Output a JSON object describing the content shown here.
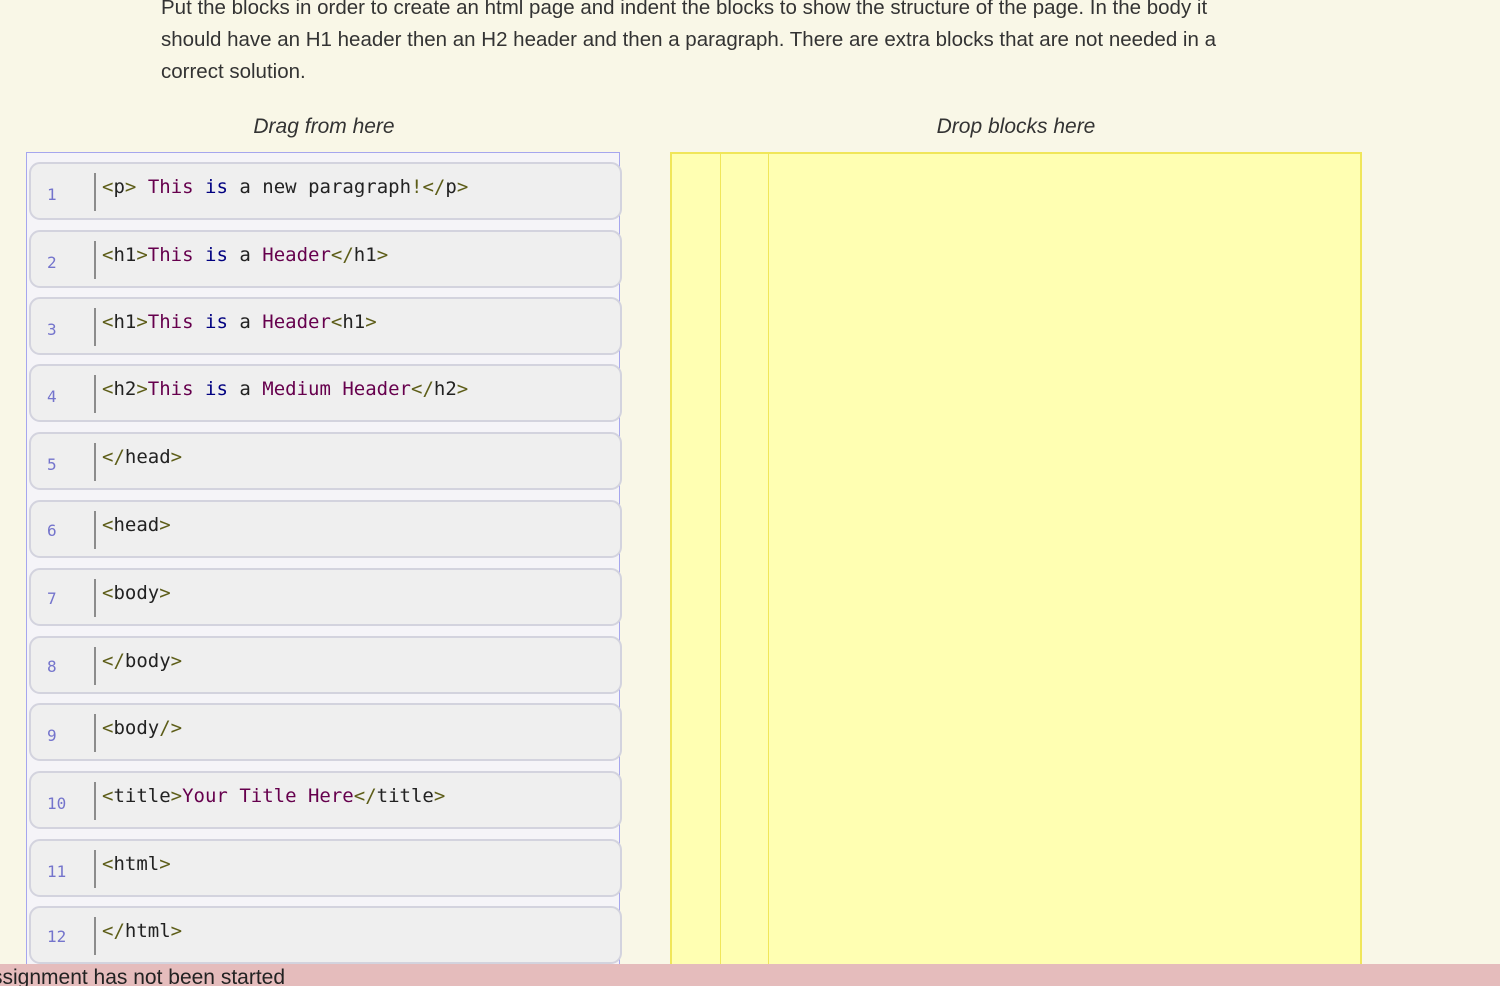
{
  "instructions": "Put the blocks in order to create an html page and indent the blocks to show the structure of the page. In the body it should have an H1 header then an H2 header and then a paragraph. There are extra blocks that are not needed in a correct solution.",
  "headings": {
    "drag": "Drag from here",
    "drop": "Drop blocks here"
  },
  "blocks": [
    {
      "number": "1",
      "code": "<p> This is a new paragraph!</p>"
    },
    {
      "number": "2",
      "code": "<h1>This is a Header</h1>"
    },
    {
      "number": "3",
      "code": "<h1>This is a Header<h1>"
    },
    {
      "number": "4",
      "code": "<h2>This is a Medium Header</h2>"
    },
    {
      "number": "5",
      "code": "</head>"
    },
    {
      "number": "6",
      "code": "<head>"
    },
    {
      "number": "7",
      "code": "<body>"
    },
    {
      "number": "8",
      "code": "</body>"
    },
    {
      "number": "9",
      "code": "<body/>"
    },
    {
      "number": "10",
      "code": "<title>Your Title Here</title>"
    },
    {
      "number": "11",
      "code": "<html>"
    },
    {
      "number": "12",
      "code": "</html>"
    }
  ],
  "status": "Assignment has not been started",
  "colors": {
    "page_background": "#f9f7e7",
    "drop_area": "#ffffb2",
    "drop_border": "#f0e65a",
    "source_border": "#a6a6ee",
    "block_background": "#efefef",
    "line_number": "#7474cc",
    "status_bar": "#e5bcbc"
  }
}
